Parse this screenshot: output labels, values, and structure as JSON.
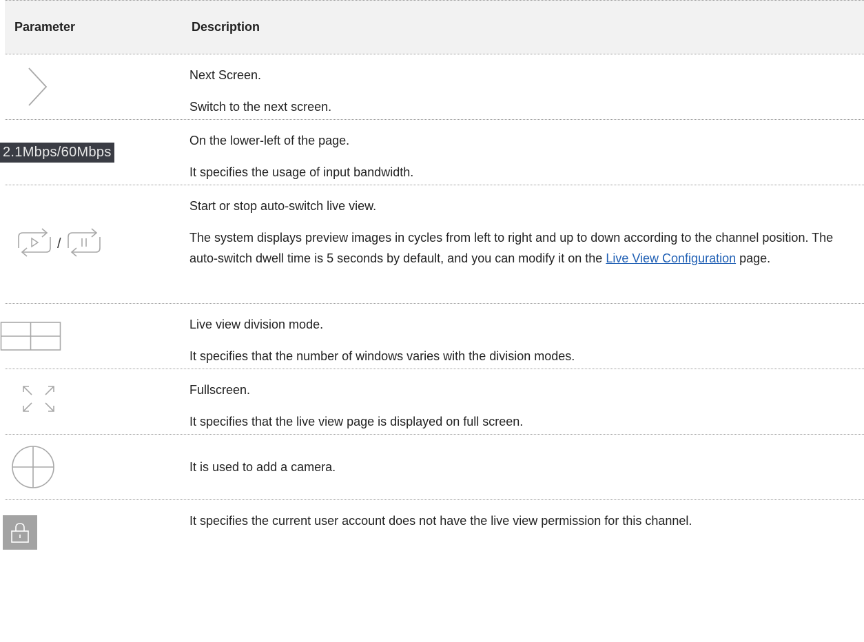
{
  "header": {
    "parameter": "Parameter",
    "description": "Description"
  },
  "rows": [
    {
      "icon": "chevron-right-icon",
      "desc": [
        "Next Screen.",
        "Switch to the next screen."
      ]
    },
    {
      "icon_text": "2.1Mbps/60Mbps",
      "desc": [
        "On the lower-left of the page.",
        "It specifies the usage of input bandwidth."
      ]
    },
    {
      "separator": "/",
      "desc": [
        "Start or stop auto-switch live view."
      ],
      "para_before": "The system displays preview images in cycles from left to right and up to down according to the channel position. The auto-switch dwell time is 5 seconds by default, and you can modify it on the ",
      "link": "Live View Configuration",
      "para_after": " page."
    },
    {
      "icon": "grid-division-icon",
      "desc": [
        "Live view division mode.",
        "It specifies that the number of windows varies with the division modes."
      ]
    },
    {
      "icon": "fullscreen-icon",
      "desc": [
        "Fullscreen.",
        "It specifies that the live view page is displayed on full screen."
      ]
    },
    {
      "icon": "add-camera-icon",
      "desc": [
        "It is used to add a camera."
      ]
    },
    {
      "icon": "lock-icon",
      "desc": [
        "It specifies the current user account does not have the live view permission for this channel."
      ]
    }
  ]
}
